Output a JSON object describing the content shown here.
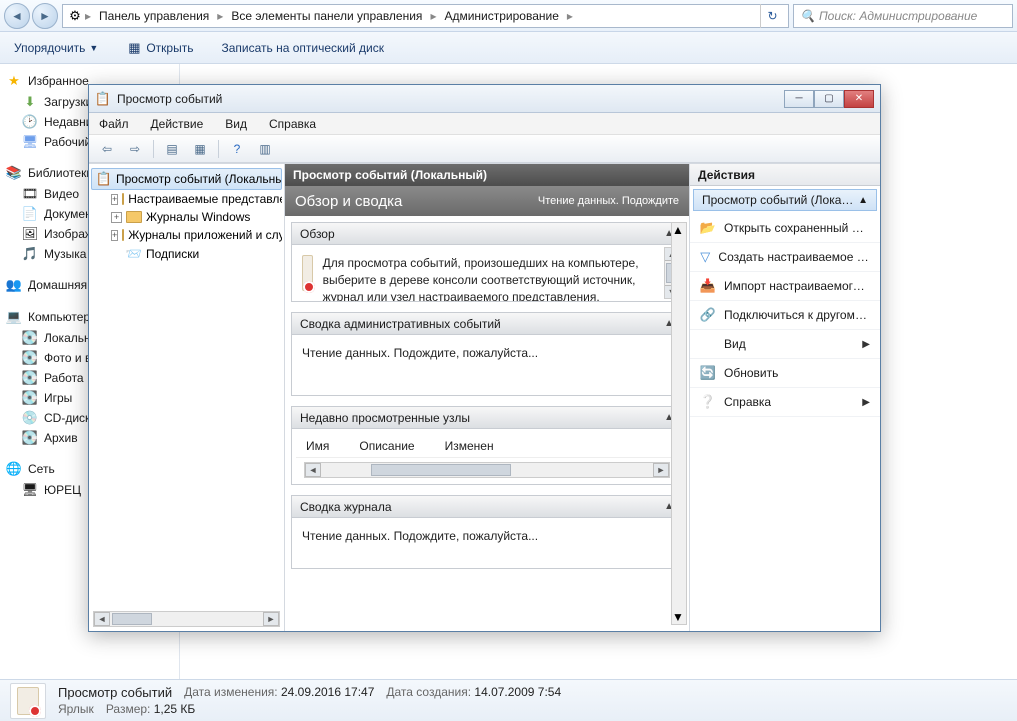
{
  "explorer": {
    "breadcrumb": [
      "Панель управления",
      "Все элементы панели управления",
      "Администрирование"
    ],
    "search_placeholder": "Поиск: Администрирование",
    "toolbar": {
      "organize": "Упорядочить",
      "open": "Открыть",
      "burn": "Записать на оптический диск"
    },
    "sidebar": {
      "favorites": {
        "title": "Избранное",
        "items": [
          "Загрузки",
          "Недавние места",
          "Рабочий стол"
        ]
      },
      "libraries": {
        "title": "Библиотеки",
        "items": [
          "Видео",
          "Документы",
          "Изображения",
          "Музыка"
        ]
      },
      "homegroup": {
        "title": "Домашняя группа"
      },
      "computer": {
        "title": "Компьютер",
        "items": [
          "Локальный диск",
          "Фото и видео",
          "Работа",
          "Игры",
          "CD-дисковод",
          "Архив"
        ]
      },
      "network": {
        "title": "Сеть",
        "items": [
          "ЮРЕЦ"
        ]
      }
    },
    "status": {
      "name": "Просмотр событий",
      "type": "Ярлык",
      "modified_label": "Дата изменения:",
      "modified": "24.09.2016 17:47",
      "size_label": "Размер:",
      "size": "1,25 КБ",
      "created_label": "Дата создания:",
      "created": "14.07.2009 7:54"
    }
  },
  "dialog": {
    "title": "Просмотр событий",
    "menus": [
      "Файл",
      "Действие",
      "Вид",
      "Справка"
    ],
    "tree": {
      "root": "Просмотр событий (Локальный)",
      "children": [
        "Настраиваемые представления",
        "Журналы Windows",
        "Журналы приложений и служб",
        "Подписки"
      ]
    },
    "center": {
      "header": "Просмотр событий (Локальный)",
      "sub_title": "Обзор и сводка",
      "sub_status": "Чтение данных. Подождите",
      "panels": {
        "overview": {
          "title": "Обзор",
          "text": "Для просмотра событий, произошедших на компьютере, выберите в дереве консоли соответствующий источник, журнал или узел настраиваемого представления. Настраиваемое"
        },
        "admin": {
          "title": "Сводка административных событий",
          "text": "Чтение данных. Подождите, пожалуйста..."
        },
        "recent": {
          "title": "Недавно просмотренные узлы",
          "cols": [
            "Имя",
            "Описание",
            "Изменен"
          ]
        },
        "log": {
          "title": "Сводка журнала",
          "text": "Чтение данных. Подождите, пожалуйста..."
        }
      }
    },
    "actions": {
      "title": "Действия",
      "group": "Просмотр событий (Локальный)",
      "items": [
        {
          "icon": "folder-open",
          "label": "Открыть сохраненный журнал..."
        },
        {
          "icon": "filter",
          "label": "Создать настраиваемое представление..."
        },
        {
          "icon": "import",
          "label": "Импорт настраиваемого представления..."
        },
        {
          "icon": "connect",
          "label": "Подключиться к другому компьютеру..."
        },
        {
          "icon": "view",
          "label": "Вид",
          "arrow": true
        },
        {
          "icon": "refresh",
          "label": "Обновить"
        },
        {
          "icon": "help",
          "label": "Справка",
          "arrow": true
        }
      ]
    }
  }
}
